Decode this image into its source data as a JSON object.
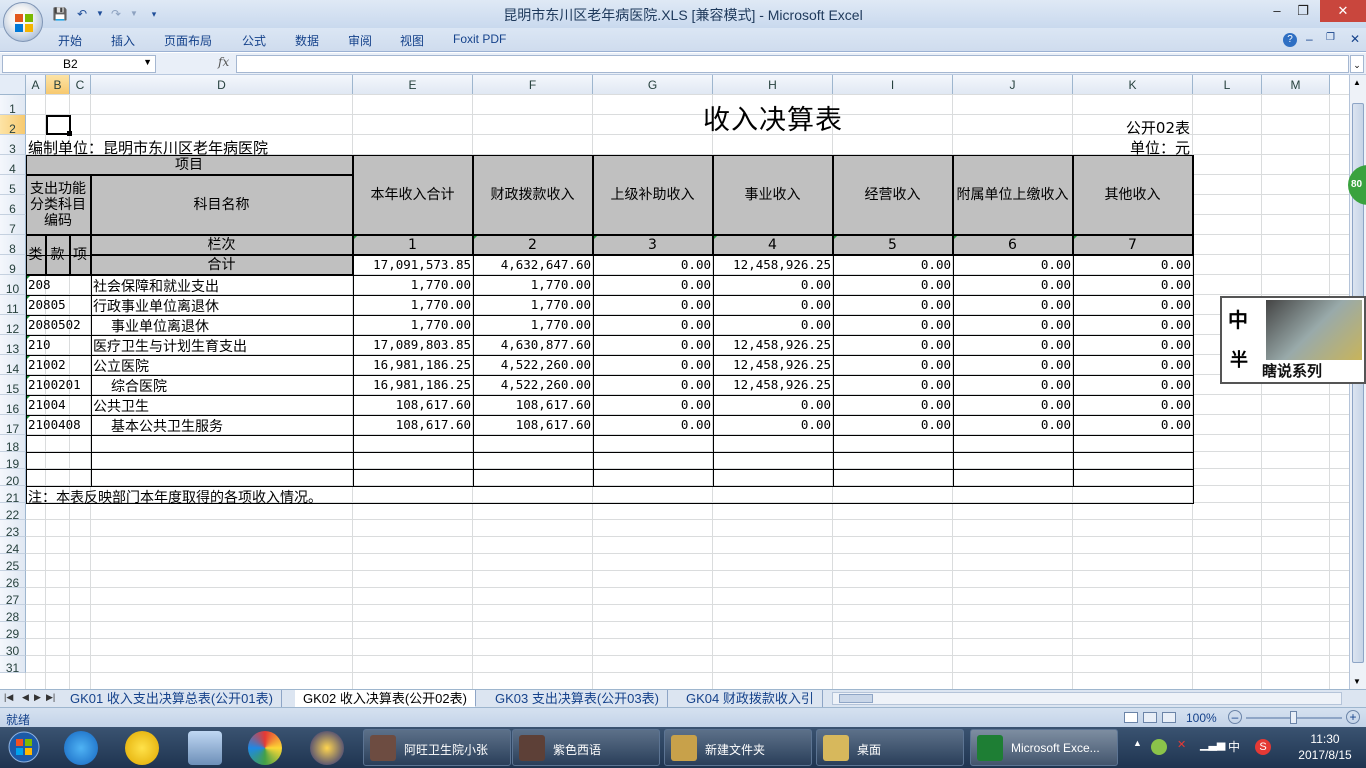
{
  "window": {
    "title": "昆明市东川区老年病医院.XLS  [兼容模式] - Microsoft Excel",
    "minimize": "–",
    "maximize": "❐",
    "close": "✕"
  },
  "ribbon": {
    "tabs": [
      "开始",
      "插入",
      "页面布局",
      "公式",
      "数据",
      "审阅",
      "视图",
      "Foxit PDF"
    ]
  },
  "formula_bar": {
    "name_box": "B2",
    "fx": "fx",
    "value": ""
  },
  "columns": [
    "A",
    "B",
    "C",
    "D",
    "E",
    "F",
    "G",
    "H",
    "I",
    "J",
    "K",
    "L",
    "M"
  ],
  "rows": [
    "1",
    "2",
    "3",
    "4",
    "5",
    "6",
    "7",
    "8",
    "9",
    "10",
    "11",
    "12",
    "13",
    "14",
    "15",
    "16",
    "17",
    "18",
    "19",
    "20",
    "21",
    "22",
    "23",
    "24",
    "25",
    "26",
    "27",
    "28",
    "29",
    "30",
    "31"
  ],
  "sheet": {
    "title": "收入决算表",
    "form_no": "公开02表",
    "unit": "单位：元",
    "compiler": "编制单位：昆明市东川区老年病医院",
    "headers": {
      "project": "项目",
      "func_code": "支出功能分类科目编码",
      "subject_name": "科目名称",
      "lei": "类",
      "kuan": "款",
      "xiang": "项",
      "lanci": "栏次",
      "heji": "合计",
      "cols": [
        "本年收入合计",
        "财政拨款收入",
        "上级补助收入",
        "事业收入",
        "经营收入",
        "附属单位上缴收入",
        "其他收入"
      ],
      "col_nums": [
        "1",
        "2",
        "3",
        "4",
        "5",
        "6",
        "7"
      ]
    },
    "total_row": [
      "17,091,573.85",
      "4,632,647.60",
      "0.00",
      "12,458,926.25",
      "0.00",
      "0.00",
      "0.00"
    ],
    "data_rows": [
      {
        "code": "208",
        "name": "社会保障和就业支出",
        "indent": false,
        "values": [
          "1,770.00",
          "1,770.00",
          "0.00",
          "0.00",
          "0.00",
          "0.00",
          "0.00"
        ]
      },
      {
        "code": "20805",
        "name": "行政事业单位离退休",
        "indent": false,
        "values": [
          "1,770.00",
          "1,770.00",
          "0.00",
          "0.00",
          "0.00",
          "0.00",
          "0.00"
        ]
      },
      {
        "code": "2080502",
        "name": "事业单位离退休",
        "indent": true,
        "values": [
          "1,770.00",
          "1,770.00",
          "0.00",
          "0.00",
          "0.00",
          "0.00",
          "0.00"
        ]
      },
      {
        "code": "210",
        "name": "医疗卫生与计划生育支出",
        "indent": false,
        "values": [
          "17,089,803.85",
          "4,630,877.60",
          "0.00",
          "12,458,926.25",
          "0.00",
          "0.00",
          "0.00"
        ]
      },
      {
        "code": "21002",
        "name": "公立医院",
        "indent": false,
        "values": [
          "16,981,186.25",
          "4,522,260.00",
          "0.00",
          "12,458,926.25",
          "0.00",
          "0.00",
          "0.00"
        ]
      },
      {
        "code": "2100201",
        "name": "综合医院",
        "indent": true,
        "values": [
          "16,981,186.25",
          "4,522,260.00",
          "0.00",
          "12,458,926.25",
          "0.00",
          "0.00",
          "0.00"
        ]
      },
      {
        "code": "21004",
        "name": "公共卫生",
        "indent": false,
        "values": [
          "108,617.60",
          "108,617.60",
          "0.00",
          "0.00",
          "0.00",
          "0.00",
          "0.00"
        ]
      },
      {
        "code": "2100408",
        "name": "基本公共卫生服务",
        "indent": true,
        "values": [
          "108,617.60",
          "108,617.60",
          "0.00",
          "0.00",
          "0.00",
          "0.00",
          "0.00"
        ]
      }
    ],
    "note": "注：本表反映部门本年度取得的各项收入情况。"
  },
  "sheet_tabs": [
    {
      "label": "GK01 收入支出决算总表(公开01表)",
      "active": false
    },
    {
      "label": "GK02 收入决算表(公开02表)",
      "active": true
    },
    {
      "label": "GK03 支出决算表(公开03表)",
      "active": false
    },
    {
      "label": "GK04 财政拨款收入引",
      "active": false
    }
  ],
  "status": {
    "ready": "就绪",
    "zoom": "100%"
  },
  "taskbar": {
    "items": [
      {
        "label": "阿旺卫生院小张",
        "active": false
      },
      {
        "label": "紫色西语",
        "active": false
      },
      {
        "label": "新建文件夹",
        "active": false
      },
      {
        "label": "桌面",
        "active": false
      },
      {
        "label": "Microsoft Exce...",
        "active": true
      }
    ],
    "ime": "中",
    "time": "11:30",
    "date": "2017/8/15"
  },
  "overlay": {
    "badge": "80",
    "widget_chars": [
      "中",
      "半"
    ],
    "widget_text": "瞎说系列"
  },
  "colors": {
    "header_fill": "#c0c0c0",
    "ribbon_text": "#15428b",
    "selection": "#f7c96f",
    "close_button": "#c9463d"
  }
}
